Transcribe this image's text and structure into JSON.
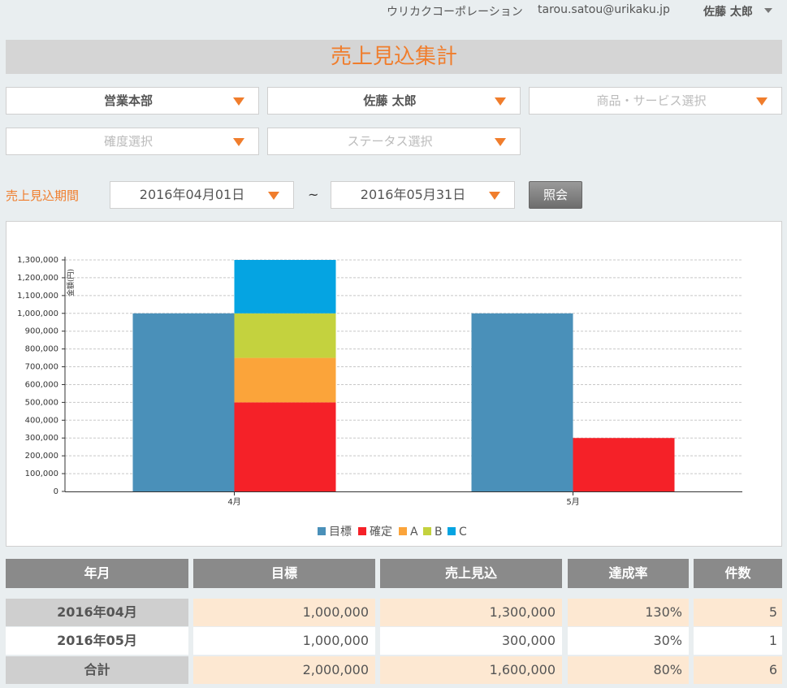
{
  "topbar": {
    "company": "ウリカクコーポレーション",
    "email": "tarou.satou@urikaku.jp",
    "user": "佐藤 太郎"
  },
  "page_title": "売上見込集計",
  "filters": {
    "department": "営業本部",
    "person": "佐藤 太郎",
    "product_placeholder": "商品・サービス選択",
    "certainty_placeholder": "確度選択",
    "status_placeholder": "ステータス選択"
  },
  "period": {
    "label": "売上見込期間",
    "start": "2016年04月01日",
    "separator": "~",
    "end": "2016年05月31日",
    "query_button": "照会"
  },
  "colors": {
    "accent": "#f07d2c",
    "target": "#4a90b9",
    "confirmed": "#f52128",
    "A": "#fba43a",
    "B": "#c4d23e",
    "C": "#05a4e2",
    "row_highlight": "#fde8d2",
    "row_label_gray": "#cfcfcf"
  },
  "chart_data": {
    "type": "bar",
    "ylabel": "金額(円)",
    "xlabel": "",
    "ylim": [
      0,
      1300000
    ],
    "yticks": [
      0,
      100000,
      200000,
      300000,
      400000,
      500000,
      600000,
      700000,
      800000,
      900000,
      1000000,
      1100000,
      1200000,
      1300000
    ],
    "ytick_labels": [
      "0",
      "100,000",
      "200,000",
      "300,000",
      "400,000",
      "500,000",
      "600,000",
      "700,000",
      "800,000",
      "900,000",
      "1,000,000",
      "1,100,000",
      "1,200,000",
      "1,300,000"
    ],
    "categories": [
      "4月",
      "5月"
    ],
    "grid": true,
    "legend_position": "bottom",
    "series": [
      {
        "name": "目標",
        "stack": "target",
        "color": "#4a90b9",
        "values": [
          1000000,
          1000000
        ]
      },
      {
        "name": "確定",
        "stack": "forecast",
        "color": "#f52128",
        "values": [
          500000,
          300000
        ]
      },
      {
        "name": "A",
        "stack": "forecast",
        "color": "#fba43a",
        "values": [
          250000,
          0
        ]
      },
      {
        "name": "B",
        "stack": "forecast",
        "color": "#c4d23e",
        "values": [
          250000,
          0
        ]
      },
      {
        "name": "C",
        "stack": "forecast",
        "color": "#05a4e2",
        "values": [
          300000,
          0
        ]
      }
    ]
  },
  "table": {
    "headers": [
      "年月",
      "目標",
      "売上見込",
      "達成率",
      "件数"
    ],
    "rows": [
      {
        "ym": "2016年04月",
        "target": "1,000,000",
        "forecast": "1,300,000",
        "rate": "130%",
        "count": "5"
      },
      {
        "ym": "2016年05月",
        "target": "1,000,000",
        "forecast": "300,000",
        "rate": "30%",
        "count": "1"
      },
      {
        "ym": "合計",
        "target": "2,000,000",
        "forecast": "1,600,000",
        "rate": "80%",
        "count": "6"
      }
    ]
  }
}
